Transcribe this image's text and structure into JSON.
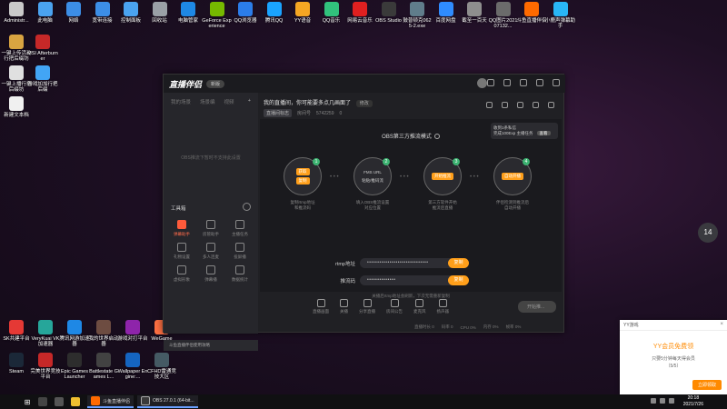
{
  "desktop_icons_top": [
    {
      "label": "Administr...",
      "color": "#c9c9c9"
    },
    {
      "label": "此电脑",
      "color": "#4aa3f0"
    },
    {
      "label": "网络",
      "color": "#3c8ee6"
    },
    {
      "label": "宽带连接",
      "color": "#3c8ee6"
    },
    {
      "label": "控制面板",
      "color": "#4aa3f0"
    },
    {
      "label": "回收站",
      "color": "#9aa0a6"
    },
    {
      "label": "电脑管家",
      "color": "#1e88e5"
    },
    {
      "label": "GeForce Experience",
      "color": "#76b900"
    },
    {
      "label": "QQ浏览器",
      "color": "#2b7de9"
    },
    {
      "label": "腾讯QQ",
      "color": "#1aa3ff"
    },
    {
      "label": "YY语音",
      "color": "#f5a623"
    },
    {
      "label": "QQ音乐",
      "color": "#31c27c"
    },
    {
      "label": "网易云音乐",
      "color": "#e02020"
    },
    {
      "label": "OBS Studio",
      "color": "#3a3a3a"
    },
    {
      "label": "鼓普顿克0625-2.exe",
      "color": "#607d8b"
    },
    {
      "label": "百度网盘",
      "color": "#2f8cff"
    },
    {
      "label": "截至一百天",
      "color": "#8e8e8e"
    },
    {
      "label": "QQ图片202107132...",
      "color": "#6b6b6b"
    },
    {
      "label": "斗鱼直播伴侣",
      "color": "#ff6a00"
    },
    {
      "label": "小鹿声弹幕助手",
      "color": "#29b6f6"
    }
  ],
  "desktop_icons_left": [
    {
      "label": "一键上传活动行把后缀坊",
      "color": "#d9a441"
    },
    {
      "label": "MSI Afterburner",
      "color": "#c62828"
    },
    {
      "label": "一键上播行把后缀坊",
      "color": "#e0e0e0"
    },
    {
      "label": "游戏加加行把后缀",
      "color": "#42a5f5"
    },
    {
      "label": "新建文本档",
      "color": "#f0f0f0"
    }
  ],
  "desktop_icons_bottom": [
    {
      "label": "SK共建平台",
      "color": "#e53935"
    },
    {
      "label": "VeryKuai VK加速器",
      "color": "#26a69a"
    },
    {
      "label": "腾讯网游加速器",
      "color": "#1e88e5"
    },
    {
      "label": "我的世界启动器",
      "color": "#6d4c41"
    },
    {
      "label": "游戏对打平台",
      "color": "#8e24aa"
    },
    {
      "label": "WeGame",
      "color": "#ff7043"
    },
    {
      "label": "Steam",
      "color": "#1b2838"
    },
    {
      "label": "完美世界竞技平台",
      "color": "#c62828"
    },
    {
      "label": "Epic Games Launcher",
      "color": "#2d2d2d"
    },
    {
      "label": "Battlestate Games L...",
      "color": "#424242"
    },
    {
      "label": "Wallpaper Engine:...",
      "color": "#1565c0"
    },
    {
      "label": "CFHD雷通竞技大区",
      "color": "#455a64"
    }
  ],
  "app": {
    "logo": "直播伴侣",
    "version_badge": "新版",
    "left_tabs": [
      "我的场景",
      "场景编",
      "视频",
      "+"
    ],
    "left_empty": "OBS推流下暂时不支持此设置",
    "toolbox_title": "工具箱",
    "tools": [
      {
        "label": "弹幕助手",
        "active": true
      },
      {
        "label": "房管助手",
        "active": false
      },
      {
        "label": "主播任务",
        "active": false
      },
      {
        "label": "礼物设置",
        "active": false
      },
      {
        "label": "多人连麦",
        "active": false
      },
      {
        "label": "投屏播",
        "active": false
      },
      {
        "label": "虚拟形象",
        "active": false
      },
      {
        "label": "弹幕播",
        "active": false
      },
      {
        "label": "数据统计",
        "active": false
      }
    ],
    "left_footer": "斗鱼直播伴侣使用攻略",
    "room_title": "我的直播间，你可能要多点几画面了",
    "room_edit": "修改",
    "room_category": "直播间标志",
    "room_id": "房间号",
    "room_id_value": "5742259",
    "room_fire": "0",
    "promo_line1": "收到1条私信",
    "promo_line2": "完成100Exp 主播任务",
    "promo_btn": "查看",
    "mode_title": "OBS第三方推流模式",
    "steps": [
      {
        "num": "1",
        "chip1": "获取",
        "chip2": "复制",
        "desc": "复制rtmp地址\n和推流码"
      },
      {
        "num": "2",
        "chip1": "FMS URL",
        "chip2": "粘贴/推码流",
        "desc": "填入OBS推流设置\n对应位置"
      },
      {
        "num": "3",
        "chip1": "开始推流",
        "chip2": "",
        "desc": "第三方软件开始\n推流后直播"
      },
      {
        "num": "4",
        "chip1": "自动开播",
        "chip2": "",
        "desc": "伴侣检测到推流后\n自动开播"
      }
    ],
    "rtmp_label": "rtmp地址",
    "rtmp_value": "••••••••••••••••••••••••••••••",
    "rtmp_btn": "复制",
    "key_label": "推流码",
    "key_value": "••••••••••••••",
    "key_btn": "复制",
    "hint": "关播后rtmp地址会刷新，下次无需重新复制",
    "bottom_items": [
      "直播画面",
      "关播",
      "分享直播",
      "房间公告",
      "麦克风",
      "扬声器"
    ],
    "start_btn": "开始推...",
    "status": [
      "直播时长 0",
      "码率 0",
      "CPU 0%",
      "内存 0%",
      "帧率 0%"
    ]
  },
  "side_num": "14",
  "toast": {
    "header": "YY游戏",
    "title": "YY会员免费领",
    "body1": "只要5分钟每天得会员",
    "body2": "（5/5）",
    "button": "立即领取"
  },
  "taskbar": {
    "task1": "斗鱼直播伴侣",
    "task2": "OBS 27.0.1 (64-bit...",
    "time": "20:18",
    "date": "2021/7/26"
  }
}
